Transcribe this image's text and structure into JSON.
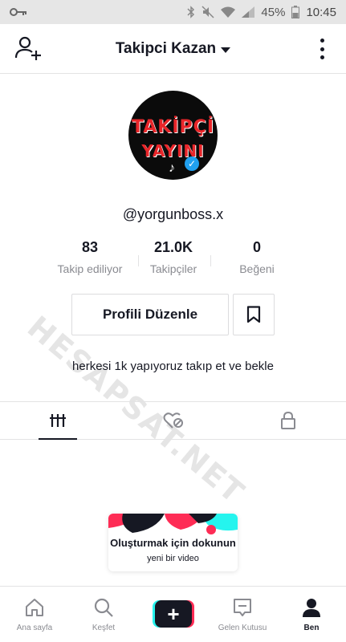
{
  "status_bar": {
    "battery": "45%",
    "time": "10:45"
  },
  "header": {
    "title": "Takipci Kazan"
  },
  "profile": {
    "avatar_text_line1": "TAKİPÇİ",
    "avatar_text_line2": "YAYINI",
    "username": "@yorgunboss.x",
    "bio": "herkesi 1k yapıyoruz takıp et ve bekle"
  },
  "stats": [
    {
      "value": "83",
      "label": "Takip ediliyor"
    },
    {
      "value": "21.0K",
      "label": "Takipçiler"
    },
    {
      "value": "0",
      "label": "Beğeni"
    }
  ],
  "buttons": {
    "edit_profile": "Profili Düzenle"
  },
  "watermark": "HESAPSAT.NET",
  "create_card": {
    "title": "Oluşturmak için dokunun",
    "subtitle": "yeni bir video"
  },
  "bottom_nav": [
    {
      "label": "Ana sayfa",
      "icon": "home-icon"
    },
    {
      "label": "Keşfet",
      "icon": "search-icon"
    },
    {
      "label": "",
      "icon": "plus-icon"
    },
    {
      "label": "Gelen Kutusu",
      "icon": "inbox-icon"
    },
    {
      "label": "Ben",
      "icon": "profile-icon"
    }
  ],
  "colors": {
    "accent_pink": "#fe2c55",
    "accent_cyan": "#25f4ee",
    "text": "#161823",
    "muted": "#8a8b91"
  }
}
